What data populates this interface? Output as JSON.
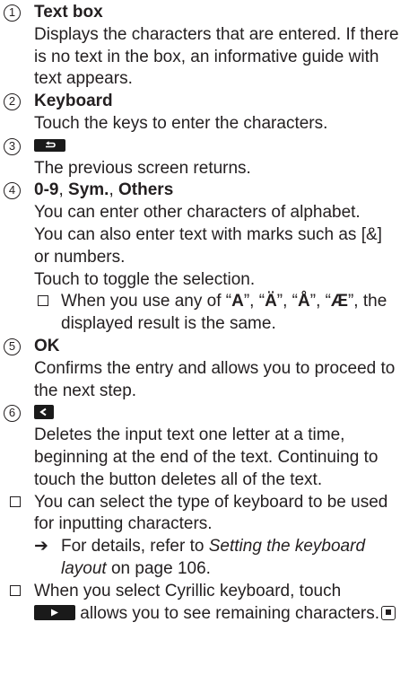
{
  "items": [
    {
      "number": "1",
      "title": "Text box",
      "description": "Displays the characters that are entered. If there is no text in the box, an informative guide with text appears."
    },
    {
      "number": "2",
      "title": "Keyboard",
      "description": "Touch the keys to enter the characters."
    },
    {
      "number": "3",
      "icon": "back-arrow-icon",
      "description": "The previous screen returns."
    },
    {
      "number": "4",
      "title_parts": [
        "0-9",
        "Sym.",
        "Others"
      ],
      "title_separator": ", ",
      "description_lines": [
        "You can enter other characters of alphabet.",
        "You can also enter text with marks such as [&]",
        "or numbers.",
        "Touch to toggle the selection."
      ],
      "note": {
        "prefix": "When you use any of “",
        "chars": [
          "A",
          "Ä",
          "Å",
          "Æ"
        ],
        "suffix": "the displayed result is the same."
      }
    },
    {
      "number": "5",
      "title": "OK",
      "description": "Confirms the entry and allows you to proceed to the next step."
    },
    {
      "number": "6",
      "icon": "delete-left-icon",
      "description": "Deletes the input text one letter at a time, beginning at the end of the text. Continuing to touch the button deletes all of the text."
    }
  ],
  "notes": {
    "keyboard_type": "You can select the type of keyboard to be used for inputting characters.",
    "reference_prefix": "For details, refer to ",
    "reference_link": "Setting the keyboard layout",
    "reference_suffix": " on page 106.",
    "cyrillic_before": "When you select Cyrillic keyboard, touch",
    "cyrillic_after": "allows you to see remaining characters."
  },
  "icons": {
    "circled_numbers": "circle-number-icon",
    "note_marker": "note-checkbox-icon",
    "reference_marker": "reference-arrow-icon",
    "back": "back-arrow-icon",
    "delete": "delete-left-icon",
    "next": "next-play-icon",
    "end": "end-mark-icon"
  }
}
